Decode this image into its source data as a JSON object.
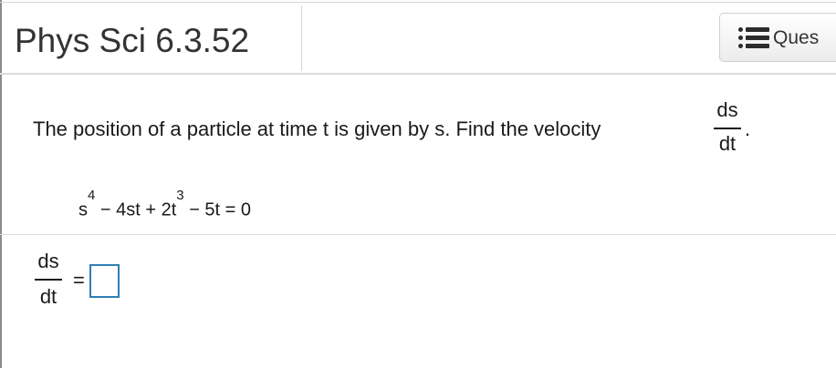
{
  "header": {
    "title": "Phys Sci 6.3.52",
    "question_button_label": "Ques",
    "question_button_icon": "list-icon"
  },
  "problem": {
    "prompt": "The position of a particle at time t is given by s. Find the velocity",
    "derivative_numerator": "ds",
    "derivative_denominator": "dt",
    "period": ".",
    "equation": {
      "t1_base": "s",
      "t1_exp": "4",
      "t2": " − 4st + 2t",
      "t2_exp": "3",
      "t3": " − 5t = 0"
    }
  },
  "answer": {
    "lhs_numerator": "ds",
    "lhs_denominator": "dt",
    "equals": "=",
    "value": ""
  },
  "colors": {
    "answer_box_border": "#2e7fb3",
    "divider": "#dcdcdc"
  }
}
